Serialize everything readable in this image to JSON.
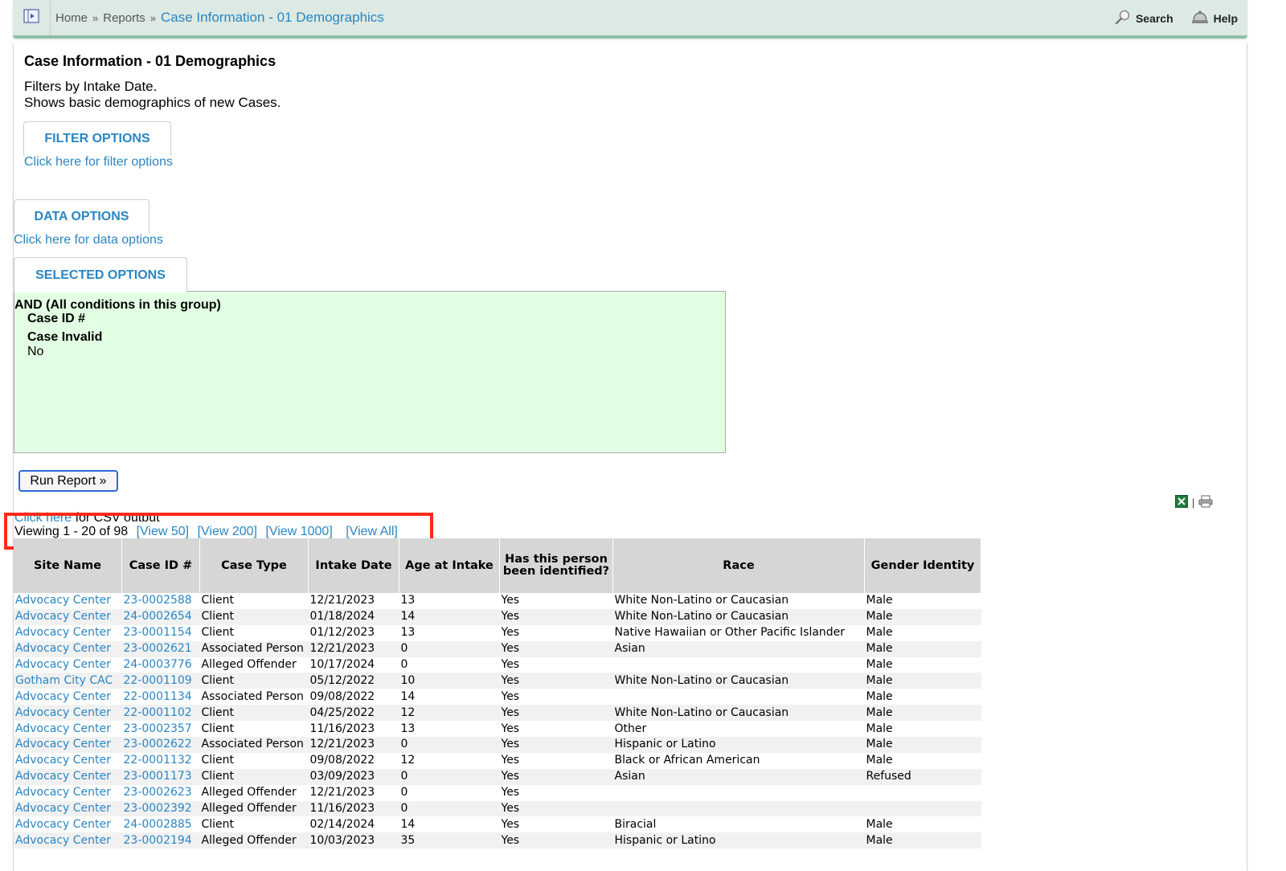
{
  "breadcrumb": {
    "home": "Home",
    "reports": "Reports",
    "separator": "»",
    "current": "Case Information - 01 Demographics"
  },
  "toolbar": {
    "search": "Search",
    "help": "Help"
  },
  "page": {
    "title": "Case Information - 01 Demographics",
    "desc_line1": "Filters by Intake Date.",
    "desc_line2": "Shows basic demographics of new Cases."
  },
  "filter_options": {
    "tab": "FILTER OPTIONS",
    "link": "Click here for filter options"
  },
  "data_options": {
    "tab": "DATA OPTIONS",
    "link": "Click here for data options"
  },
  "selected_options": {
    "tab": "SELECTED OPTIONS",
    "group": "AND (All conditions in this group)",
    "cond1_label": "Case ID #",
    "cond2_label": "Case Invalid",
    "cond2_value": "No"
  },
  "run_button": "Run Report »",
  "csv": {
    "link": "Click here",
    "text": " for CSV output"
  },
  "pagination": {
    "viewing": "Viewing 1 - 20 of 98",
    "view50": "[View 50]",
    "view200": "[View 200]",
    "view1000": "[View 1000]",
    "viewAll": "[View All]"
  },
  "table": {
    "headers": [
      "Site Name",
      "Case ID #",
      "Case Type",
      "Intake Date",
      "Age at Intake",
      "Has this person been identified?",
      "Race",
      "Gender Identity"
    ],
    "rows": [
      [
        "Advocacy Center",
        "23-0002588",
        "Client",
        "12/21/2023",
        "13",
        "Yes",
        "White Non-Latino or Caucasian",
        "Male"
      ],
      [
        "Advocacy Center",
        "24-0002654",
        "Client",
        "01/18/2024",
        "14",
        "Yes",
        "White Non-Latino or Caucasian",
        "Male"
      ],
      [
        "Advocacy Center",
        "23-0001154",
        "Client",
        "01/12/2023",
        "13",
        "Yes",
        "Native Hawaiian or Other Pacific Islander",
        "Male"
      ],
      [
        "Advocacy Center",
        "23-0002621",
        "Associated Person",
        "12/21/2023",
        "0",
        "Yes",
        "Asian",
        "Male"
      ],
      [
        "Advocacy Center",
        "24-0003776",
        "Alleged Offender",
        "10/17/2024",
        "0",
        "Yes",
        "",
        "Male"
      ],
      [
        "Gotham City CAC",
        "22-0001109",
        "Client",
        "05/12/2022",
        "10",
        "Yes",
        "White Non-Latino or Caucasian",
        "Male"
      ],
      [
        "Advocacy Center",
        "22-0001134",
        "Associated Person",
        "09/08/2022",
        "14",
        "Yes",
        "",
        "Male"
      ],
      [
        "Advocacy Center",
        "22-0001102",
        "Client",
        "04/25/2022",
        "12",
        "Yes",
        "White Non-Latino or Caucasian",
        "Male"
      ],
      [
        "Advocacy Center",
        "23-0002357",
        "Client",
        "11/16/2023",
        "13",
        "Yes",
        "Other",
        "Male"
      ],
      [
        "Advocacy Center",
        "23-0002622",
        "Associated Person",
        "12/21/2023",
        "0",
        "Yes",
        "Hispanic or Latino",
        "Male"
      ],
      [
        "Advocacy Center",
        "22-0001132",
        "Client",
        "09/08/2022",
        "12",
        "Yes",
        "Black or African American",
        "Male"
      ],
      [
        "Advocacy Center",
        "23-0001173",
        "Client",
        "03/09/2023",
        "0",
        "Yes",
        "Asian",
        "Refused"
      ],
      [
        "Advocacy Center",
        "23-0002623",
        "Alleged Offender",
        "12/21/2023",
        "0",
        "Yes",
        "",
        ""
      ],
      [
        "Advocacy Center",
        "23-0002392",
        "Alleged Offender",
        "11/16/2023",
        "0",
        "Yes",
        "",
        ""
      ],
      [
        "Advocacy Center",
        "24-0002885",
        "Client",
        "02/14/2024",
        "14",
        "Yes",
        "Biracial",
        "Male"
      ],
      [
        "Advocacy Center",
        "23-0002194",
        "Alleged Offender",
        "10/03/2023",
        "35",
        "Yes",
        "Hispanic or Latino",
        "Male"
      ]
    ]
  }
}
